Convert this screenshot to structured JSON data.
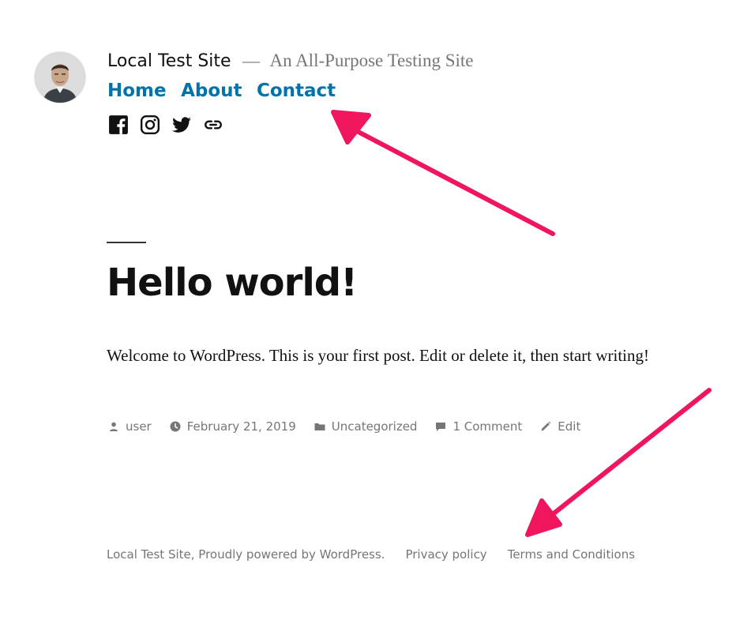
{
  "header": {
    "site_title": "Local Test Site",
    "separator": "—",
    "site_description": "An All-Purpose Testing Site",
    "avatar_icon": "avatar-photo",
    "nav": [
      "Home",
      "About",
      "Contact"
    ],
    "social_icons": [
      "facebook-icon",
      "instagram-icon",
      "twitter-icon",
      "link-icon"
    ]
  },
  "post": {
    "title": "Hello world!",
    "body": "Welcome to WordPress. This is your first post. Edit or delete it, then start writing!",
    "meta": {
      "author": "user",
      "date": "February 21, 2019",
      "category": "Uncategorized",
      "comments": "1 Comment",
      "edit": "Edit"
    }
  },
  "footer": {
    "credit": "Local Test Site, Proudly powered by WordPress.",
    "privacy": "Privacy policy",
    "terms": "Terms and Conditions"
  },
  "colors": {
    "link": "#0073aa",
    "text": "#111111",
    "muted": "#767676",
    "annotation_arrow": "#f0165e"
  }
}
